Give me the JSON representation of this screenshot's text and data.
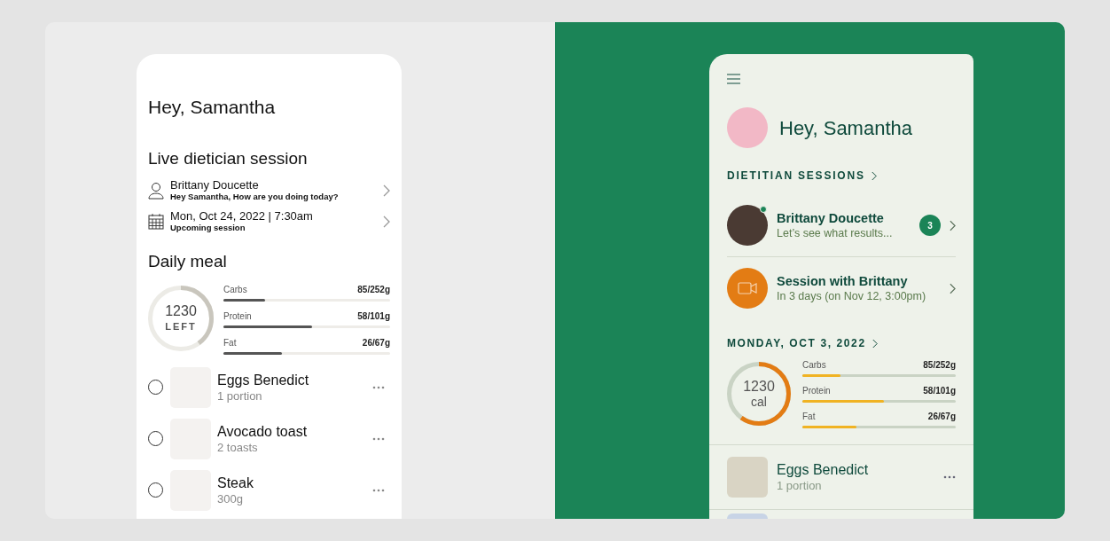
{
  "left_screen": {
    "greeting": "Hey, Samantha",
    "section_title": "Live dietician session",
    "sessions": [
      {
        "kind": "person",
        "title": "Brittany Doucette",
        "subtitle": "Hey Samantha, How are you doing today?"
      },
      {
        "kind": "calendar",
        "title": "Mon, Oct 24, 2022 | 7:30am",
        "subtitle": "Upcoming session"
      }
    ],
    "meal_title": "Daily meal",
    "calories": {
      "value": "1230",
      "unit": "LEFT",
      "level": 0.4
    },
    "macros": [
      {
        "name": "Carbs",
        "amount": "85/252g",
        "level": 0.25
      },
      {
        "name": "Protein",
        "amount": "58/101g",
        "level": 0.53
      },
      {
        "name": "Fat",
        "amount": "26/67g",
        "level": 0.35
      }
    ],
    "meals": [
      {
        "name": "Eggs Benedict",
        "detail": "1 portion",
        "checked": false
      },
      {
        "name": "Avocado toast",
        "detail": "2 toasts",
        "checked": false
      },
      {
        "name": "Steak",
        "detail": "300g",
        "checked": false
      }
    ]
  },
  "right_screen": {
    "greeting": "Hey, Samantha",
    "section_title": "DIETITIAN SESSIONS",
    "sessions": [
      {
        "kind": "chat",
        "title": "Brittany Doucette",
        "subtitle": "Let’s see what results...",
        "online": true,
        "badge": "3"
      },
      {
        "kind": "video",
        "title": "Session with Brittany",
        "subtitle": "In 3 days (on Nov 12, 3:00pm)"
      }
    ],
    "date_title": "MONDAY, OCT 3, 2022",
    "calories": {
      "value": "1230",
      "unit": "cal",
      "level": 0.6
    },
    "macros": [
      {
        "name": "Carbs",
        "amount": "85/252g",
        "level": 0.25
      },
      {
        "name": "Protein",
        "amount": "58/101g",
        "level": 0.53
      },
      {
        "name": "Fat",
        "amount": "26/67g",
        "level": 0.35
      }
    ],
    "meals": [
      {
        "name": "Eggs Benedict",
        "detail": "1 portion"
      }
    ]
  }
}
